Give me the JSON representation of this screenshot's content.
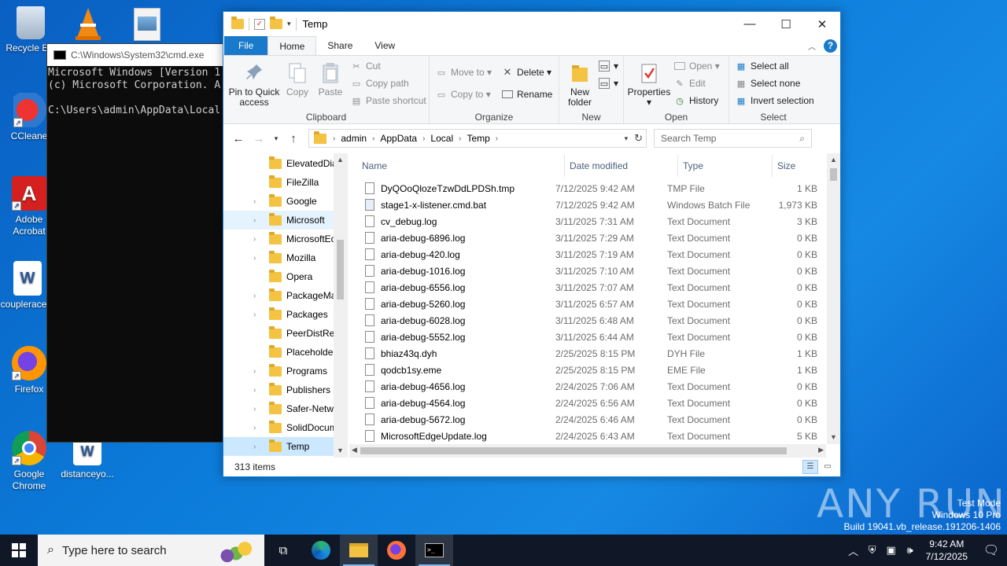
{
  "desktop": {
    "icons": [
      {
        "label": "Recycle Bin"
      },
      {
        "label": "CCleaner"
      },
      {
        "label": "Adobe Acrobat"
      },
      {
        "label": "couplerace..."
      },
      {
        "label": "Firefox"
      },
      {
        "label": "Google Chrome"
      },
      {
        "label": "distanceyo..."
      }
    ]
  },
  "cmd": {
    "title": "C:\\Windows\\System32\\cmd.exe",
    "lines": [
      "Microsoft Windows [Version 1",
      "(c) Microsoft Corporation. A",
      "",
      "C:\\Users\\admin\\AppData\\Local"
    ]
  },
  "explorer": {
    "title": "Temp",
    "tabs": {
      "file": "File",
      "home": "Home",
      "share": "Share",
      "view": "View"
    },
    "ribbon": {
      "clipboard": {
        "group": "Clipboard",
        "pin": "Pin to Quick access",
        "copy": "Copy",
        "paste": "Paste",
        "cut": "Cut",
        "copy_path": "Copy path",
        "paste_shortcut": "Paste shortcut"
      },
      "organize": {
        "group": "Organize",
        "move_to": "Move to",
        "copy_to": "Copy to",
        "delete": "Delete",
        "rename": "Rename"
      },
      "new": {
        "group": "New",
        "new_folder": "New folder"
      },
      "open": {
        "group": "Open",
        "properties": "Properties",
        "open": "Open",
        "edit": "Edit",
        "history": "History"
      },
      "select": {
        "group": "Select",
        "select_all": "Select all",
        "select_none": "Select none",
        "invert": "Invert selection"
      }
    },
    "address": {
      "crumbs": [
        "admin",
        "AppData",
        "Local",
        "Temp"
      ]
    },
    "search_placeholder": "Search Temp",
    "nav_items": [
      {
        "label": "ElevatedDia",
        "expand": false
      },
      {
        "label": "FileZilla",
        "expand": false
      },
      {
        "label": "Google",
        "expand": true
      },
      {
        "label": "Microsoft",
        "expand": true
      },
      {
        "label": "MicrosoftEc",
        "expand": true
      },
      {
        "label": "Mozilla",
        "expand": true
      },
      {
        "label": "Opera",
        "expand": false
      },
      {
        "label": "PackageMa",
        "expand": true
      },
      {
        "label": "Packages",
        "expand": true
      },
      {
        "label": "PeerDistRep",
        "expand": false
      },
      {
        "label": "Placeholder",
        "expand": false
      },
      {
        "label": "Programs",
        "expand": true
      },
      {
        "label": "Publishers",
        "expand": true
      },
      {
        "label": "Safer-Netwo",
        "expand": true
      },
      {
        "label": "SolidDocum",
        "expand": true
      },
      {
        "label": "Temp",
        "expand": true
      }
    ],
    "columns": {
      "name": "Name",
      "date": "Date modified",
      "type": "Type",
      "size": "Size"
    },
    "files": [
      {
        "name": "DyQOoQlozeTzwDdLPDSh.tmp",
        "date": "7/12/2025 9:42 AM",
        "type": "TMP File",
        "size": "1 KB"
      },
      {
        "name": "stage1-x-listener.cmd.bat",
        "date": "7/12/2025 9:42 AM",
        "type": "Windows Batch File",
        "size": "1,973 KB"
      },
      {
        "name": "cv_debug.log",
        "date": "3/11/2025 7:31 AM",
        "type": "Text Document",
        "size": "3 KB"
      },
      {
        "name": "aria-debug-6896.log",
        "date": "3/11/2025 7:29 AM",
        "type": "Text Document",
        "size": "0 KB"
      },
      {
        "name": "aria-debug-420.log",
        "date": "3/11/2025 7:19 AM",
        "type": "Text Document",
        "size": "0 KB"
      },
      {
        "name": "aria-debug-1016.log",
        "date": "3/11/2025 7:10 AM",
        "type": "Text Document",
        "size": "0 KB"
      },
      {
        "name": "aria-debug-6556.log",
        "date": "3/11/2025 7:07 AM",
        "type": "Text Document",
        "size": "0 KB"
      },
      {
        "name": "aria-debug-5260.log",
        "date": "3/11/2025 6:57 AM",
        "type": "Text Document",
        "size": "0 KB"
      },
      {
        "name": "aria-debug-6028.log",
        "date": "3/11/2025 6:48 AM",
        "type": "Text Document",
        "size": "0 KB"
      },
      {
        "name": "aria-debug-5552.log",
        "date": "3/11/2025 6:44 AM",
        "type": "Text Document",
        "size": "0 KB"
      },
      {
        "name": "bhiaz43q.dyh",
        "date": "2/25/2025 8:15 PM",
        "type": "DYH File",
        "size": "1 KB"
      },
      {
        "name": "qodcb1sy.eme",
        "date": "2/25/2025 8:15 PM",
        "type": "EME File",
        "size": "1 KB"
      },
      {
        "name": "aria-debug-4656.log",
        "date": "2/24/2025 7:06 AM",
        "type": "Text Document",
        "size": "0 KB"
      },
      {
        "name": "aria-debug-4564.log",
        "date": "2/24/2025 6:56 AM",
        "type": "Text Document",
        "size": "0 KB"
      },
      {
        "name": "aria-debug-5672.log",
        "date": "2/24/2025 6:46 AM",
        "type": "Text Document",
        "size": "0 KB"
      },
      {
        "name": "MicrosoftEdgeUpdate.log",
        "date": "2/24/2025 6:43 AM",
        "type": "Text Document",
        "size": "5 KB"
      }
    ],
    "status": "313 items"
  },
  "watermark": {
    "brand": "ANY RUN",
    "line1": "Test Mode",
    "line2": "Windows 10 Pro",
    "line3": "Build 19041.vb_release.191206-1406"
  },
  "taskbar": {
    "search_placeholder": "Type here to search",
    "time": "9:42 AM",
    "date": "7/12/2025"
  },
  "colors": {
    "accent": "#1979ca",
    "selection": "#cce8ff",
    "taskbar": "#101827"
  }
}
